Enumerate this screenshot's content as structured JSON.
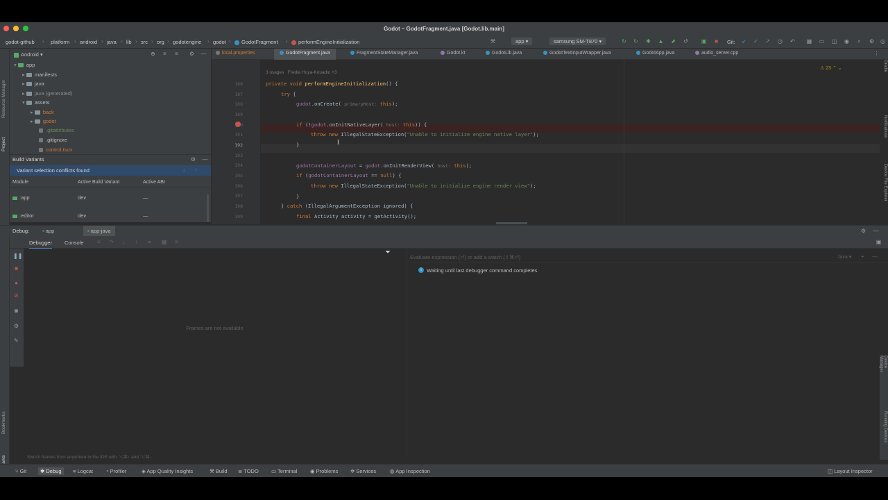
{
  "window": {
    "title": "Godot – GodotFragment.java [Godot.lib.main]"
  },
  "breadcrumb": [
    "godot-github",
    "platform",
    "android",
    "java",
    "lib",
    "src",
    "org",
    "godotengine",
    "godot",
    "GodotFragment",
    "performEngineInitialization"
  ],
  "toolbar": {
    "run_config": "app",
    "device": "samsung SM-T870",
    "git_label": "Git:"
  },
  "project": {
    "view_label": "Android",
    "tree": [
      {
        "label": "app",
        "color": "#bbbbbb"
      },
      {
        "label": "manifests",
        "color": "#bbbbbb"
      },
      {
        "label": "java",
        "color": "#bbbbbb"
      },
      {
        "label": "java (generated)",
        "color": "#8a8a8a"
      },
      {
        "label": "assets",
        "color": "#bbbbbb"
      },
      {
        "label": "back",
        "color": "#cc7832"
      },
      {
        "label": "godot",
        "color": "#cc7832"
      },
      {
        "label": ".gitattributes",
        "color": "#6a8759"
      },
      {
        "label": ".gitignore",
        "color": "#bbbbbb"
      },
      {
        "label": "control.tscn",
        "color": "#cc7832"
      }
    ]
  },
  "build_variants": {
    "title": "Build Variants",
    "conflict": "Variant selection conflicts found",
    "headers": [
      "Module",
      "Active Build Variant",
      "Active ABI"
    ],
    "rows": [
      {
        "module": ":app",
        "variant": "dev",
        "abi": "—"
      },
      {
        "module": ":editor",
        "variant": "dev",
        "abi": "—"
      }
    ]
  },
  "editor": {
    "tabs": [
      "local.properties",
      "GodotFragment.java",
      "FragmentStateManager.java",
      "Godot.kt",
      "GodotLib.java",
      "GodotTextInputWrapper.java",
      "GodotApp.java",
      "audio_server.cpp"
    ],
    "usages": "3 usages",
    "author": "Fredia Huya-Kouadio +3",
    "warnings": "23",
    "lines": [
      "186",
      "187",
      "188",
      "189",
      "190",
      "191",
      "192",
      "193",
      "194",
      "195",
      "196",
      "197",
      "198",
      "199"
    ]
  },
  "debug": {
    "label": "Debug:",
    "config_tabs": [
      "app",
      "app-java"
    ],
    "tabs": [
      "Debugger",
      "Console"
    ],
    "frames_empty": "Frames are not available",
    "eval_placeholder": "Evaluate expression (⏎) or add a watch (⇧⌘⏎)",
    "lang": "Java",
    "waiting": "Waiting until last debugger command completes",
    "hint": "Switch frames from anywhere in the IDE with ⌥⌘↑ and ⌥⌘↓"
  },
  "statusbar": [
    "Git",
    "Debug",
    "Logcat",
    "Profiler",
    "App Quality Insights",
    "Build",
    "TODO",
    "Terminal",
    "Problems",
    "Services",
    "App Inspection"
  ],
  "statusbar_right": "Layout Inspector",
  "side_labels": {
    "left": [
      "Resource Manager",
      "Project",
      "Bookmarks",
      "Build Variants"
    ],
    "right": [
      "Gradle",
      "Device Manager",
      "Notifications",
      "Running Devices",
      "Device File Explorer"
    ]
  }
}
